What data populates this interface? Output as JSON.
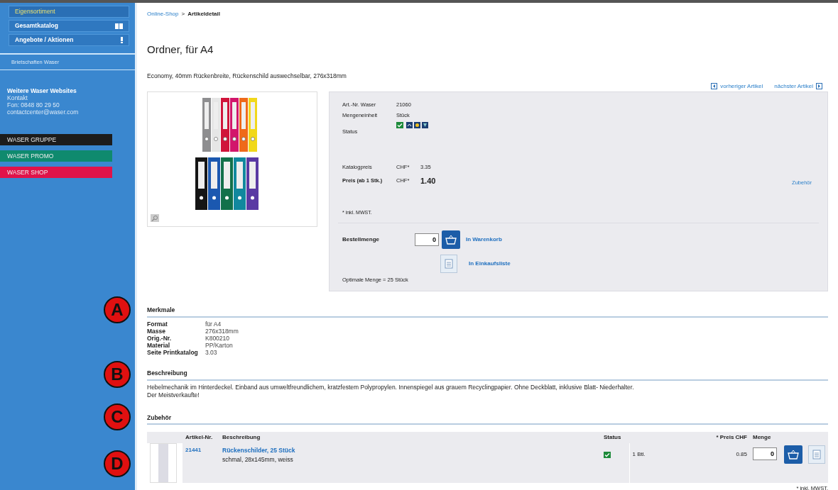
{
  "sidebar": {
    "nav": [
      {
        "label": "Eigensortiment",
        "selected": true,
        "kind": "plain"
      },
      {
        "label": "Gesamtkatalog",
        "selected": false,
        "kind": "catalog"
      },
      {
        "label": "Angebote / Aktionen",
        "selected": false,
        "kind": "offers"
      }
    ],
    "sub_link": "Brietschaften Waser",
    "contact": {
      "title": "Weitere Waser Websites",
      "lines": [
        "Kontakt",
        "Fon: 0848 80 29 50",
        "contactcenter@waser.com"
      ]
    },
    "sites": [
      {
        "label": "WASER GRUPPE",
        "color": "#1c1c1c"
      },
      {
        "label": "WASER PROMO",
        "color": "#0f8a6e"
      },
      {
        "label": "WASER SHOP",
        "color": "#e0134a"
      }
    ]
  },
  "breadcrumb": {
    "link": "Online-Shop",
    "separator": ">",
    "current": "Artikeldetail"
  },
  "title": "Ordner, für A4",
  "subtitle": "Economy, 40mm Rückenbreite, Rückenschild auswechselbar, 276x318mm",
  "pager": {
    "prev": "vorheriger Artikel",
    "next": "nächster Artikel"
  },
  "info": {
    "fields": [
      {
        "label": "Art.-Nr. Waser",
        "value": "21060"
      },
      {
        "label": "Mengeneinheit",
        "value": "Stück"
      }
    ],
    "status_label": "Status",
    "prices": [
      {
        "label": "Katalogpreis",
        "currency": "CHF*",
        "value": "3.35",
        "emphasis": false
      },
      {
        "label": "Preis (ab 1 Stk.)",
        "currency": "CHF*",
        "value": "1.40",
        "emphasis": true
      }
    ],
    "accessory_link": "Zubehör",
    "vat_note": "* inkl. MWST.",
    "order_label": "Bestellmenge",
    "quantity": "0",
    "cart_button": "In Warenkorb",
    "list_button": "In Einkaufsliste",
    "optimal": "Optimale Menge = 25 Stück"
  },
  "features": {
    "heading": "Merkmale",
    "rows": [
      {
        "label": "Format",
        "value": "für A4"
      },
      {
        "label": "Masse",
        "value": "276x318mm"
      },
      {
        "label": "Orig.-Nr.",
        "value": "K800210"
      },
      {
        "label": "Material",
        "value": "PP/Karton"
      },
      {
        "label": "Seite Printkatalog",
        "value": "3.03"
      }
    ]
  },
  "description": {
    "heading": "Beschreibung",
    "lines": [
      "Hebelmechanik im Hinterdeckel. Einband aus umweltfreundlichem, kratzfestem Polypropylen. Innenspiegel aus grauem Recyclingpapier. Ohne Deckblatt, inklusive Blatt- Niederhalter.",
      "Der Meistverkaufte!"
    ]
  },
  "accessories": {
    "heading": "Zubehör",
    "columns": [
      "Artikel-Nr.",
      "Beschreibung",
      "Status",
      "* Preis CHF",
      "Menge"
    ],
    "rows": [
      {
        "number": "21441",
        "name": "Rückenschilder, 25 Stück",
        "detail": "schmal, 28x145mm, weiss",
        "available": true,
        "unit": "1 Btl.",
        "price": "0.85",
        "quantity": "0"
      }
    ],
    "vat_note": "* inkl. MWST."
  },
  "annotations": [
    "A",
    "B",
    "C",
    "D"
  ]
}
